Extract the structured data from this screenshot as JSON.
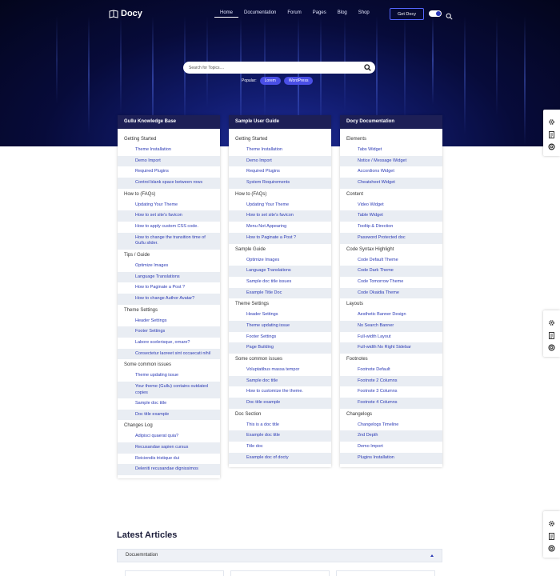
{
  "brand": {
    "name": "Docy"
  },
  "nav": {
    "items": [
      "Home",
      "Documentation",
      "Forum",
      "Pages",
      "Blog",
      "Shop"
    ],
    "active": "Home",
    "cta": "Get Docy"
  },
  "search": {
    "placeholder": "Search for Topics....",
    "popular_label": "Popular:",
    "tags": [
      "Lorem",
      "WordPress"
    ]
  },
  "colors": {
    "accent": "#4a4fe6",
    "card_header": "#1d1f56",
    "link": "#2b3ab5",
    "alt_row": "#e9edf3"
  },
  "cards": [
    {
      "title": "Gullu Knowledge Base",
      "sections": [
        {
          "title": "Getting Started",
          "items": [
            "Theme Installation",
            "Demo Import",
            "Required Plugins",
            "Control blank space between rows"
          ]
        },
        {
          "title": "How to (FAQs)",
          "items": [
            "Updating Your Theme",
            "How to set site's favicon",
            "How to apply custom CSS code.",
            "How to change the transition time of Gullu slider."
          ]
        },
        {
          "title": "Tips / Guide",
          "items": [
            "Optimize Images",
            "Language Translations",
            "How to Paginate a Post ?",
            "How to change Author Avatar?"
          ]
        },
        {
          "title": "Theme Settings",
          "items": [
            "Header Settings",
            "Footer Settings",
            "Labore scelerisque, ornare?",
            "Consectetur laoreet sint occaecati nihil"
          ]
        },
        {
          "title": "Some common issues",
          "items": [
            "Theme updating issue",
            "Your theme (Gullu) contains outdated copies",
            "Sample doc title",
            "Doc title example"
          ]
        },
        {
          "title": "Changes Log",
          "items": [
            "Adipisci quaerat quia?",
            "Recusandae sapien cursus",
            "Reiciendis tristique dui",
            "Deleniti recusandae dignissimos"
          ]
        }
      ]
    },
    {
      "title": "Sample User Guide",
      "sections": [
        {
          "title": "Getting Started",
          "items": [
            "Theme Installation",
            "Demo Import",
            "Required Plugins",
            "System Requirements"
          ]
        },
        {
          "title": "How to (FAQs)",
          "items": [
            "Updating Your Theme",
            "How to set site's favicon",
            "Menu Not Appearing",
            "How to Paginate a Post ?"
          ]
        },
        {
          "title": "Sample Guide",
          "items": [
            "Optimize Images",
            "Language Translations",
            "Sample doc title issues",
            "Example Title Doc"
          ]
        },
        {
          "title": "Theme Settings",
          "items": [
            "Header Settings",
            "Theme updating issue",
            "Footer Settings",
            "Page Building"
          ]
        },
        {
          "title": "Some common issues",
          "items": [
            "Voluptatibus massa tempor",
            "Sample doc title",
            "How to customize the theme.",
            "Doc title example"
          ]
        },
        {
          "title": "Doc Section",
          "items": [
            "This is a doc title",
            "Example doc title",
            "Title doc",
            "Example doc of docty"
          ]
        }
      ]
    },
    {
      "title": "Docy Documentation",
      "sections": [
        {
          "title": "Elements",
          "items": [
            "Tabs Widget",
            "Notice / Message Widget",
            "Accordions Widget",
            "Cheatsheet Widget"
          ]
        },
        {
          "title": "Content",
          "items": [
            "Video Widget",
            "Table Widget",
            "Tooltip & Direction",
            "Password Protected doc"
          ]
        },
        {
          "title": "Code Syntax Highlight",
          "items": [
            "Code Default Theme",
            "Code Dark Theme",
            "Code Tomorrow Theme",
            "Code Okaidia Theme"
          ]
        },
        {
          "title": "Layouts",
          "items": [
            "Aesthetic Banner Design",
            "No Search Banner",
            "Full-width Layout",
            "Full-width No Right Sidebar"
          ]
        },
        {
          "title": "Footnotes",
          "items": [
            "Footnote Default",
            "Footnote 2 Columns",
            "Footnote 3 Columns",
            "Footnote 4 Columns"
          ]
        },
        {
          "title": "Changelogs",
          "items": [
            "Changelogs Timeline",
            "2nd Depth",
            "Demo Import",
            "Plugins Installation"
          ]
        }
      ]
    }
  ],
  "latest": {
    "title": "Latest Articles",
    "accordion": "Docuemntation"
  },
  "side_panel": {
    "icons": [
      "gear-icon",
      "document-icon",
      "lifebuoy-icon"
    ]
  }
}
